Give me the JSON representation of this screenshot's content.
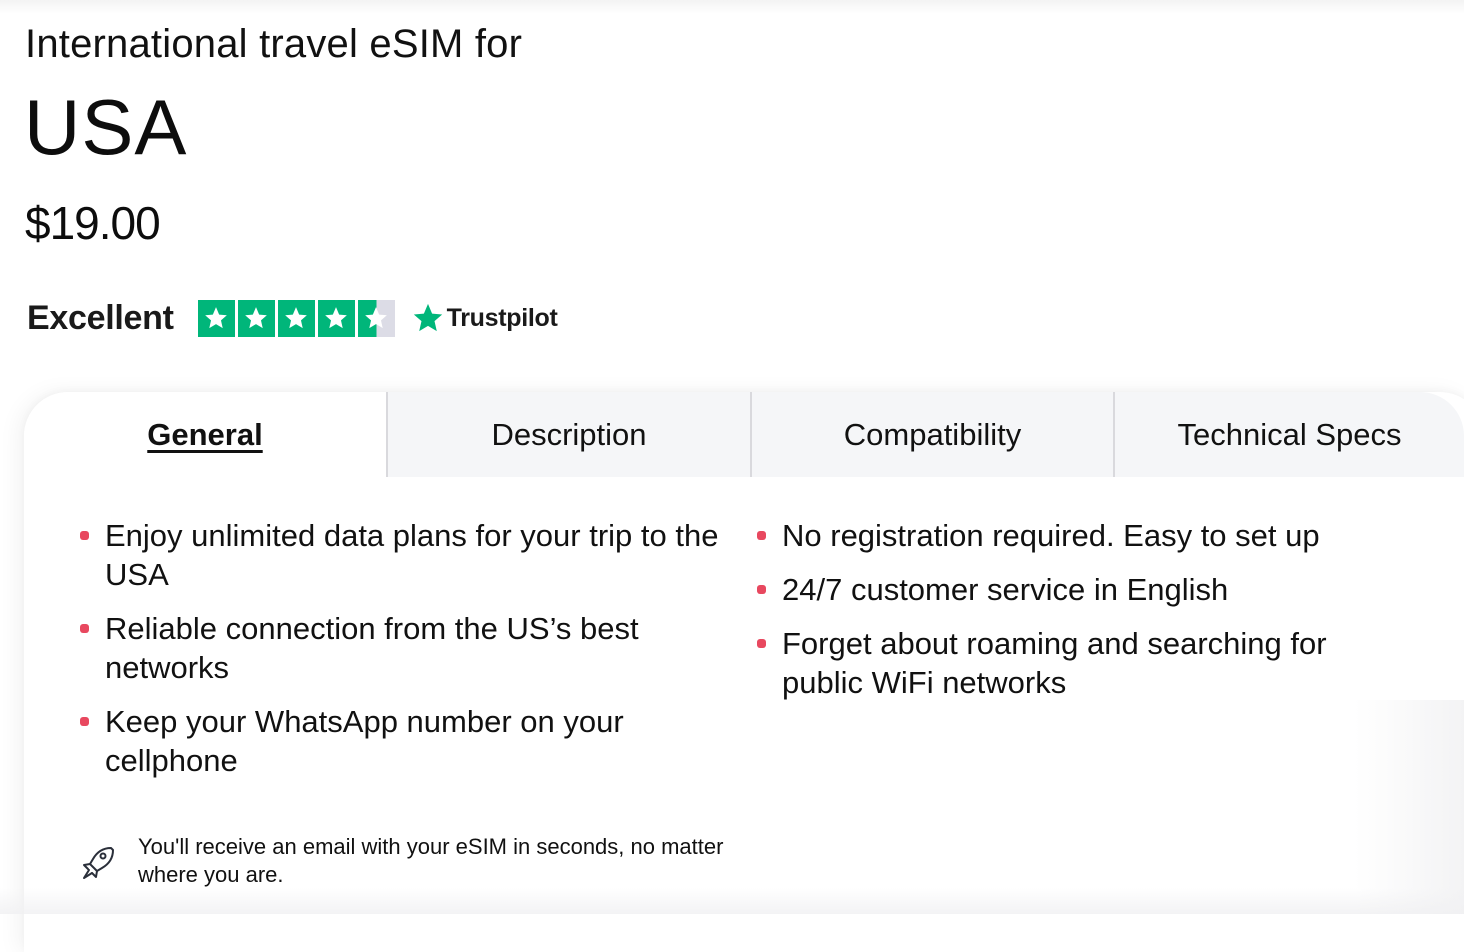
{
  "header": {
    "subtitle": "International travel eSIM for",
    "country": "USA",
    "price": "$19.00"
  },
  "rating": {
    "label": "Excellent",
    "stars_value": 4.5,
    "stars_max": 5,
    "provider": "Trustpilot",
    "star_color": "#00b67a",
    "star_empty_color": "#dcdce6"
  },
  "tabs": [
    {
      "label": "General",
      "active": true
    },
    {
      "label": "Description",
      "active": false
    },
    {
      "label": "Compatibility",
      "active": false
    },
    {
      "label": "Technical Specs",
      "active": false
    }
  ],
  "features": {
    "bullet_color": "#e8485f",
    "left": [
      "Enjoy unlimited data plans for your trip to the USA",
      "Reliable connection from the US’s best networks",
      "Keep your WhatsApp number on your cellphone"
    ],
    "right": [
      "No registration required. Easy to set up",
      "24/7 customer service in English",
      "Forget about roaming and searching for public WiFi networks"
    ]
  },
  "note": {
    "icon": "rocket-icon",
    "text": "You'll receive an email with your eSIM in seconds, no matter where you are."
  }
}
